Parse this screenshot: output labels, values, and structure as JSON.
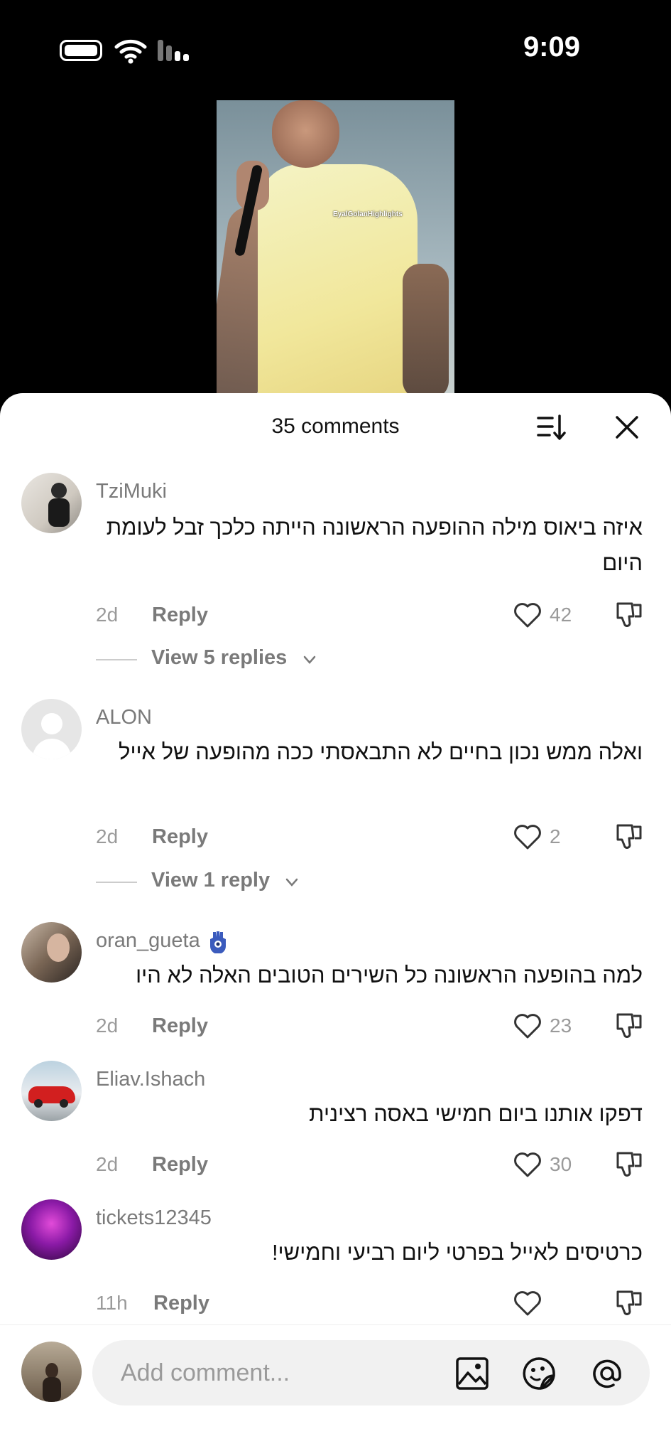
{
  "status_bar": {
    "time": "9:09"
  },
  "video": {
    "watermark": "EyalGolanHighlights"
  },
  "comments_sheet": {
    "title": "35 comments",
    "comments": [
      {
        "username": "TziMuki",
        "text": "איזה ביאוס מילה ההופעה הראשונה הייתה כלכך זבל לעומת היום",
        "time": "2d",
        "reply_label": "Reply",
        "likes": "42",
        "view_replies": "View 5 replies"
      },
      {
        "username": "ALON",
        "text": "ואלה ממש נכון בחיים לא התבאסתי ככה מהופעה של אייל",
        "time": "2d",
        "reply_label": "Reply",
        "likes": "2",
        "view_replies": "View 1 reply"
      },
      {
        "username": "oran_gueta",
        "text": "למה בהופעה הראשונה כל השירים הטובים האלה לא היו",
        "time": "2d",
        "reply_label": "Reply",
        "likes": "23"
      },
      {
        "username": "Eliav.Ishach",
        "text": "דפקו אותנו ביום חמישי באסה רצינית",
        "time": "2d",
        "reply_label": "Reply",
        "likes": "30"
      },
      {
        "username": "tickets12345",
        "text": "כרטיסים לאייל בפרטי ליום רביעי וחמישי!",
        "time": "11h",
        "reply_label": "Reply",
        "likes": ""
      }
    ]
  },
  "input": {
    "placeholder": "Add comment..."
  },
  "icons": {
    "battery": "battery-icon",
    "wifi": "wifi-icon",
    "signal": "signal-icon",
    "sort": "sort-icon",
    "close": "close-icon",
    "like": "heart-icon",
    "dislike": "thumbs-down-icon",
    "image": "image-icon",
    "sticker": "sticker-icon",
    "mention": "at-icon"
  },
  "colors": {
    "text": "#111111",
    "secondary": "#7a7a7a",
    "muted": "#9a9a9a",
    "sheet_bg": "#ffffff",
    "input_bg": "#f1f1f1"
  }
}
